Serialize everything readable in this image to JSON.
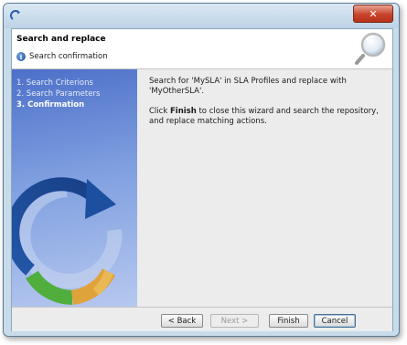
{
  "window": {
    "title": "",
    "close_glyph": "✕"
  },
  "header": {
    "title": "Search and replace",
    "subtitle": "Search confirmation",
    "info_icon": "info-icon",
    "banner_icon": "magnifier-icon"
  },
  "steps": [
    {
      "label": "1. Search Criterions",
      "current": false
    },
    {
      "label": "2. Search Parameters",
      "current": false
    },
    {
      "label": "3. Confirmation",
      "current": true
    }
  ],
  "content": {
    "line1": "Search for 'MySLA' in SLA Profiles and replace with 'MyOtherSLA'.",
    "line2_prefix": "Click ",
    "line2_bold": "Finish",
    "line2_suffix": " to close this wizard and search the repository, and replace matching actions."
  },
  "buttons": {
    "back": "< Back",
    "next": "Next >",
    "finish": "Finish",
    "cancel": "Cancel"
  },
  "colors": {
    "sidepanel": "#4d70c9",
    "logo_blue": "#1d4fa0",
    "logo_green": "#4fae3c",
    "logo_orange": "#e0a23a"
  }
}
